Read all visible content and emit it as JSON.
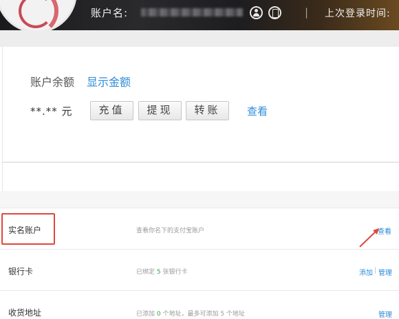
{
  "header": {
    "account_label": "账户名:",
    "separator": "|",
    "last_login_label": "上次登录时间:"
  },
  "balance": {
    "title": "账户余额",
    "show_amount_link": "显示金额",
    "amount": "**.** 元",
    "recharge_button": "充值",
    "withdraw_button": "提现",
    "transfer_button": "转账",
    "view_link": "查看"
  },
  "rows": [
    {
      "label": "实名账户",
      "description": "查看你名下的支付宝账户",
      "actions": [
        "查看"
      ]
    },
    {
      "label": "银行卡",
      "description_prefix": "已绑定 ",
      "description_count": "5",
      "description_suffix": " 张银行卡",
      "actions": [
        "添加",
        "管理"
      ],
      "separator": "|"
    },
    {
      "label": "收货地址",
      "description_prefix": "已添加 ",
      "description_count": "0",
      "description_suffix": " 个地址，最多可添加 5 个地址",
      "actions": [
        "管理"
      ]
    }
  ],
  "colors": {
    "link": "#2c8bd8",
    "highlight": "#e0473a",
    "count_green": "#3aa04a"
  },
  "icons": [
    "user-icon",
    "phone-icon",
    "arrow-annotation-icon"
  ]
}
